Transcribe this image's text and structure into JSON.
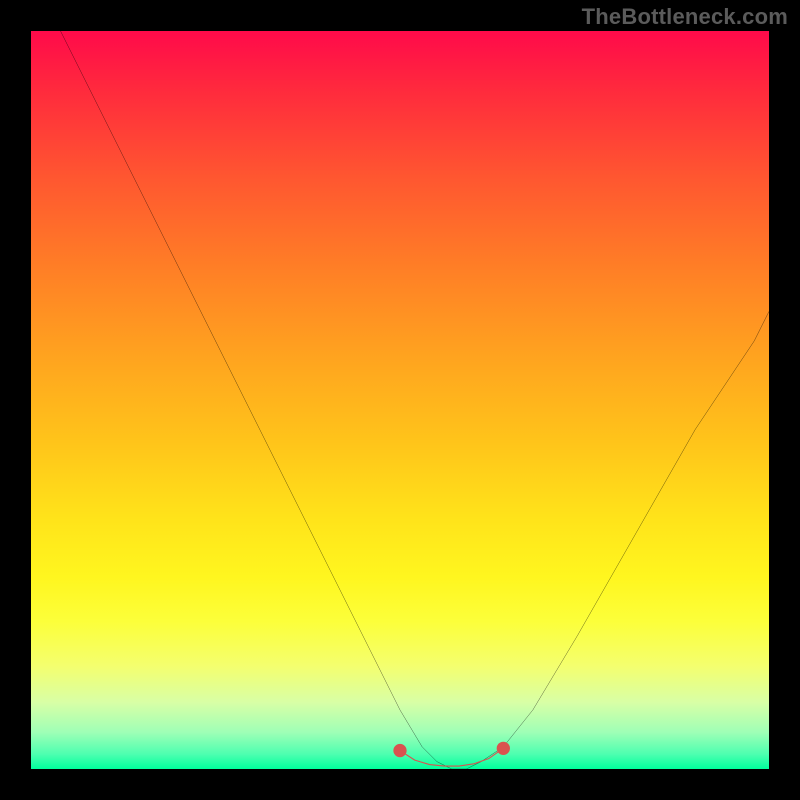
{
  "watermark": "TheBottleneck.com",
  "chart_data": {
    "type": "line",
    "title": "",
    "xlabel": "",
    "ylabel": "",
    "xlim": [
      0,
      100
    ],
    "ylim": [
      0,
      100
    ],
    "grid": false,
    "legend": false,
    "series": [
      {
        "name": "black-curve",
        "color": "#000000",
        "x": [
          4,
          10,
          18,
          26,
          34,
          40,
          46,
          50,
          53,
          55,
          57,
          59,
          61,
          64,
          68,
          74,
          82,
          90,
          98,
          100
        ],
        "y": [
          100,
          88,
          72,
          56,
          40,
          28,
          16,
          8,
          3,
          1,
          0,
          0,
          1,
          3,
          8,
          18,
          32,
          46,
          58,
          62
        ]
      },
      {
        "name": "red-bottom-segment",
        "color": "#d9534f",
        "x": [
          50,
          52,
          54,
          56,
          58,
          60,
          62,
          64
        ],
        "y": [
          2.5,
          1.2,
          0.6,
          0.4,
          0.4,
          0.7,
          1.4,
          2.8
        ]
      }
    ],
    "background_gradient": {
      "direction": "top-to-bottom",
      "stops": [
        {
          "pos": 0,
          "color": "#ff0a4a"
        },
        {
          "pos": 20,
          "color": "#ff5730"
        },
        {
          "pos": 44,
          "color": "#ffa31f"
        },
        {
          "pos": 66,
          "color": "#ffe31a"
        },
        {
          "pos": 86,
          "color": "#f4ff6e"
        },
        {
          "pos": 100,
          "color": "#00ff9c"
        }
      ]
    }
  }
}
